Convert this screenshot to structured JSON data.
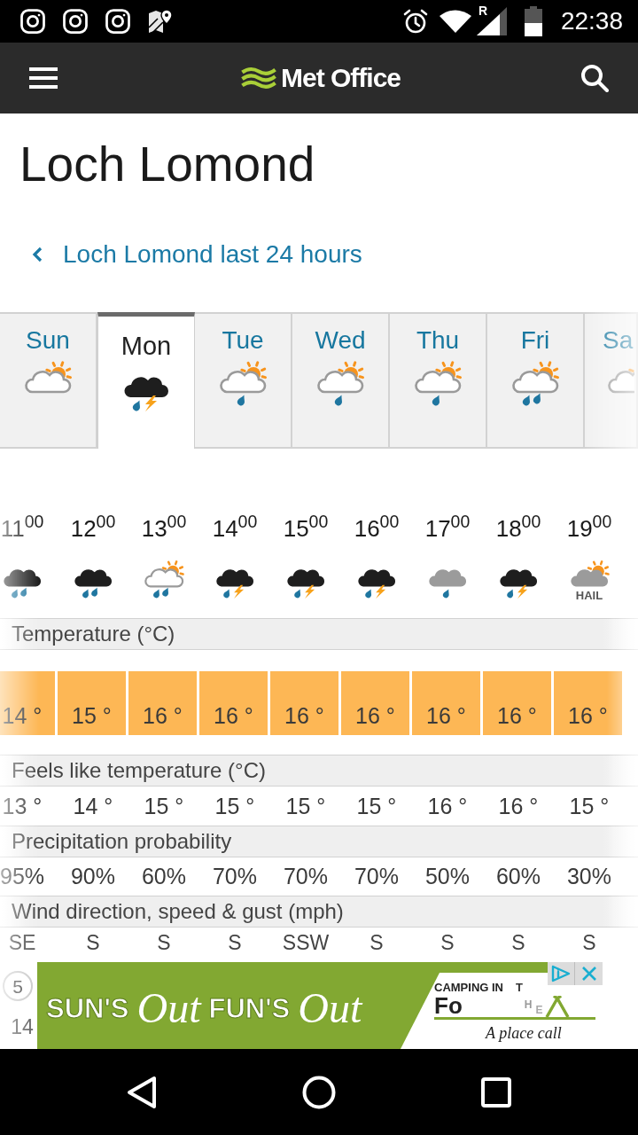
{
  "status_bar": {
    "network_badge": "R",
    "time": "22:38"
  },
  "header": {
    "logo_text": "Met Office"
  },
  "location": {
    "title": "Loch Lomond",
    "back_link": "Loch Lomond last 24 hours"
  },
  "days": [
    {
      "label": "Sun",
      "kind": "sun-cloud",
      "selected": false
    },
    {
      "label": "Mon",
      "kind": "thunder",
      "selected": true
    },
    {
      "label": "Tue",
      "kind": "sun-cloud-drop",
      "selected": false
    },
    {
      "label": "Wed",
      "kind": "sun-cloud-drop",
      "selected": false
    },
    {
      "label": "Thu",
      "kind": "sun-cloud-drop",
      "selected": false
    },
    {
      "label": "Fri",
      "kind": "sun-cloud-drops",
      "selected": false
    },
    {
      "label": "Sa",
      "kind": "sun-cloud",
      "selected": false
    }
  ],
  "row_headings": {
    "temperature": "Temperature (°C)",
    "feels_like": "Feels like temperature (°C)",
    "precipitation": "Precipitation probability",
    "wind": "Wind direction, speed & gust (mph)"
  },
  "hours": [
    {
      "time": "11$^{00}$",
      "kind": "heavy-rain",
      "temperature": "14 °",
      "feels_like": "13 °",
      "precipitation": "95%",
      "wind_direction": "SE",
      "wind_speed": "5",
      "wind_gust": "14"
    },
    {
      "time": "12$^{00}$",
      "kind": "heavy-rain",
      "temperature": "15 °",
      "feels_like": "14 °",
      "precipitation": "90%",
      "wind_direction": "S"
    },
    {
      "time": "13$^{00}$",
      "kind": "sun-cloud-drops",
      "temperature": "16 °",
      "feels_like": "15 °",
      "precipitation": "60%",
      "wind_direction": "S"
    },
    {
      "time": "14$^{00}$",
      "kind": "thunder",
      "temperature": "16 °",
      "feels_like": "15 °",
      "precipitation": "70%",
      "wind_direction": "S"
    },
    {
      "time": "15$^{00}$",
      "kind": "thunder",
      "temperature": "16 °",
      "feels_like": "15 °",
      "precipitation": "70%",
      "wind_direction": "SSW"
    },
    {
      "time": "16$^{00}$",
      "kind": "thunder",
      "temperature": "16 °",
      "feels_like": "15 °",
      "precipitation": "70%",
      "wind_direction": "S"
    },
    {
      "time": "17$^{00}$",
      "kind": "rain",
      "temperature": "16 °",
      "feels_like": "16 °",
      "precipitation": "50%",
      "wind_direction": "S"
    },
    {
      "time": "18$^{00}$",
      "kind": "thunder",
      "temperature": "16 °",
      "feels_like": "16 °",
      "precipitation": "60%",
      "wind_direction": "S"
    },
    {
      "time": "19$^{00}$",
      "kind": "sun-grey-cloud",
      "note": "HAIL",
      "temperature": "16 °",
      "feels_like": "15 °",
      "precipitation": "30%",
      "wind_direction": "S"
    }
  ],
  "ad": {
    "headline": [
      {
        "text": "SUN'S",
        "kind": "block"
      },
      {
        "text": "Out",
        "kind": "script"
      },
      {
        "text": "FUN'S",
        "kind": "block"
      },
      {
        "text": "Out",
        "kind": "script"
      }
    ],
    "brand_line": "CAMPING IN",
    "brand_cut": "Fo",
    "brand_letters": [
      "T",
      "H",
      "E"
    ],
    "tagline": "A place call"
  }
}
